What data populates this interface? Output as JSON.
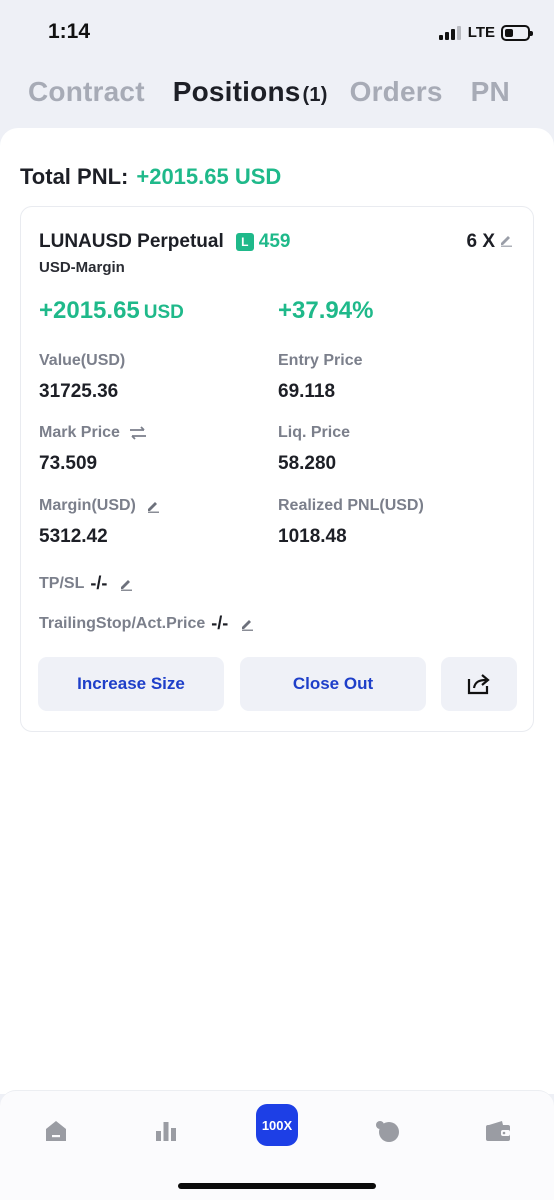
{
  "status_bar": {
    "time": "1:14",
    "network": "LTE"
  },
  "tabs": [
    {
      "label": "Contract"
    },
    {
      "label": "Positions",
      "count": "(1)"
    },
    {
      "label": "Orders"
    },
    {
      "label": "PN"
    }
  ],
  "total_pnl": {
    "label": "Total PNL:",
    "value": "+2015.65 USD"
  },
  "position": {
    "symbol": "LUNAUSD Perpetual",
    "side_badge": "L",
    "quantity": "459",
    "margin_type": "USD-Margin",
    "leverage": "6 X",
    "pnl_value": "+2015.65",
    "pnl_unit": "USD",
    "pnl_percent": "+37.94%",
    "fields": {
      "value_label": "Value(USD)",
      "value": "31725.36",
      "entry_price_label": "Entry Price",
      "entry_price": "69.118",
      "mark_price_label": "Mark Price",
      "mark_price": "73.509",
      "liq_price_label": "Liq. Price",
      "liq_price": "58.280",
      "margin_label": "Margin(USD)",
      "margin": "5312.42",
      "realized_pnl_label": "Realized PNL(USD)",
      "realized_pnl": "1018.48",
      "tpsl_label": "TP/SL",
      "tpsl": "-/-",
      "trailing_label": "TrailingStop/Act.Price",
      "trailing": "-/-"
    },
    "buttons": {
      "increase_size": "Increase Size",
      "close_out": "Close Out"
    }
  },
  "bottom_nav": {
    "center_label": "100X",
    "items": [
      "home-icon",
      "markets-icon",
      "100x-button",
      "coin-icon",
      "wallet-icon"
    ]
  },
  "colors": {
    "profit_green": "#1fb98a",
    "action_blue": "#1e3fc9",
    "center_nav_blue": "#1d3fe6"
  }
}
